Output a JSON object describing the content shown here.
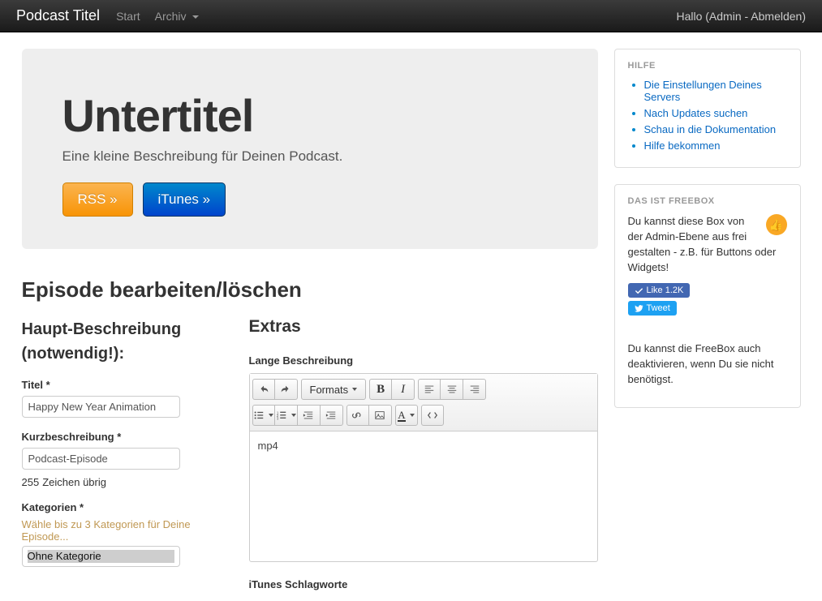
{
  "navbar": {
    "brand": "Podcast Titel",
    "start": "Start",
    "archiv": "Archiv",
    "greeting": "Hallo",
    "username": "",
    "admin": "Admin",
    "logout": "Abmelden"
  },
  "hero": {
    "title": "Untertitel",
    "subtitle": "Eine kleine Beschreibung für Deinen Podcast.",
    "rss_btn": "RSS »",
    "itunes_btn": "iTunes »"
  },
  "section_title": "Episode bearbeiten/löschen",
  "form": {
    "main_heading": "Haupt-Beschreibung (notwendig!):",
    "title_label": "Titel *",
    "title_value": "Happy New Year Animation",
    "short_label": "Kurzbeschreibung *",
    "short_value": "Podcast-Episode",
    "chars_num": "255",
    "chars_text": "Zeichen übrig",
    "cat_label": "Kategorien *",
    "cat_hint": "Wähle bis zu 3 Kategorien für Deine Episode...",
    "cat_selected": "Ohne Kategorie"
  },
  "extras": {
    "heading": "Extras",
    "long_label": "Lange Beschreibung",
    "formats_btn": "Formats",
    "body_text": "mp4",
    "itunes_tags": "iTunes Schlagworte"
  },
  "help": {
    "heading": "Hilfe",
    "items": [
      "Die Einstellungen Deines Servers",
      "Nach Updates suchen",
      "Schau in die Dokumentation",
      "Hilfe bekommen"
    ]
  },
  "freebox": {
    "heading": "Das ist Freebox",
    "text1": "Du kannst diese Box von der Admin-Ebene aus frei gestalten - z.B. für Buttons oder Widgets!",
    "like_label": "Like 1.2K",
    "tweet_label": "Tweet",
    "text2": "Du kannst die FreeBox auch deaktivieren, wenn Du sie nicht benötigst."
  }
}
